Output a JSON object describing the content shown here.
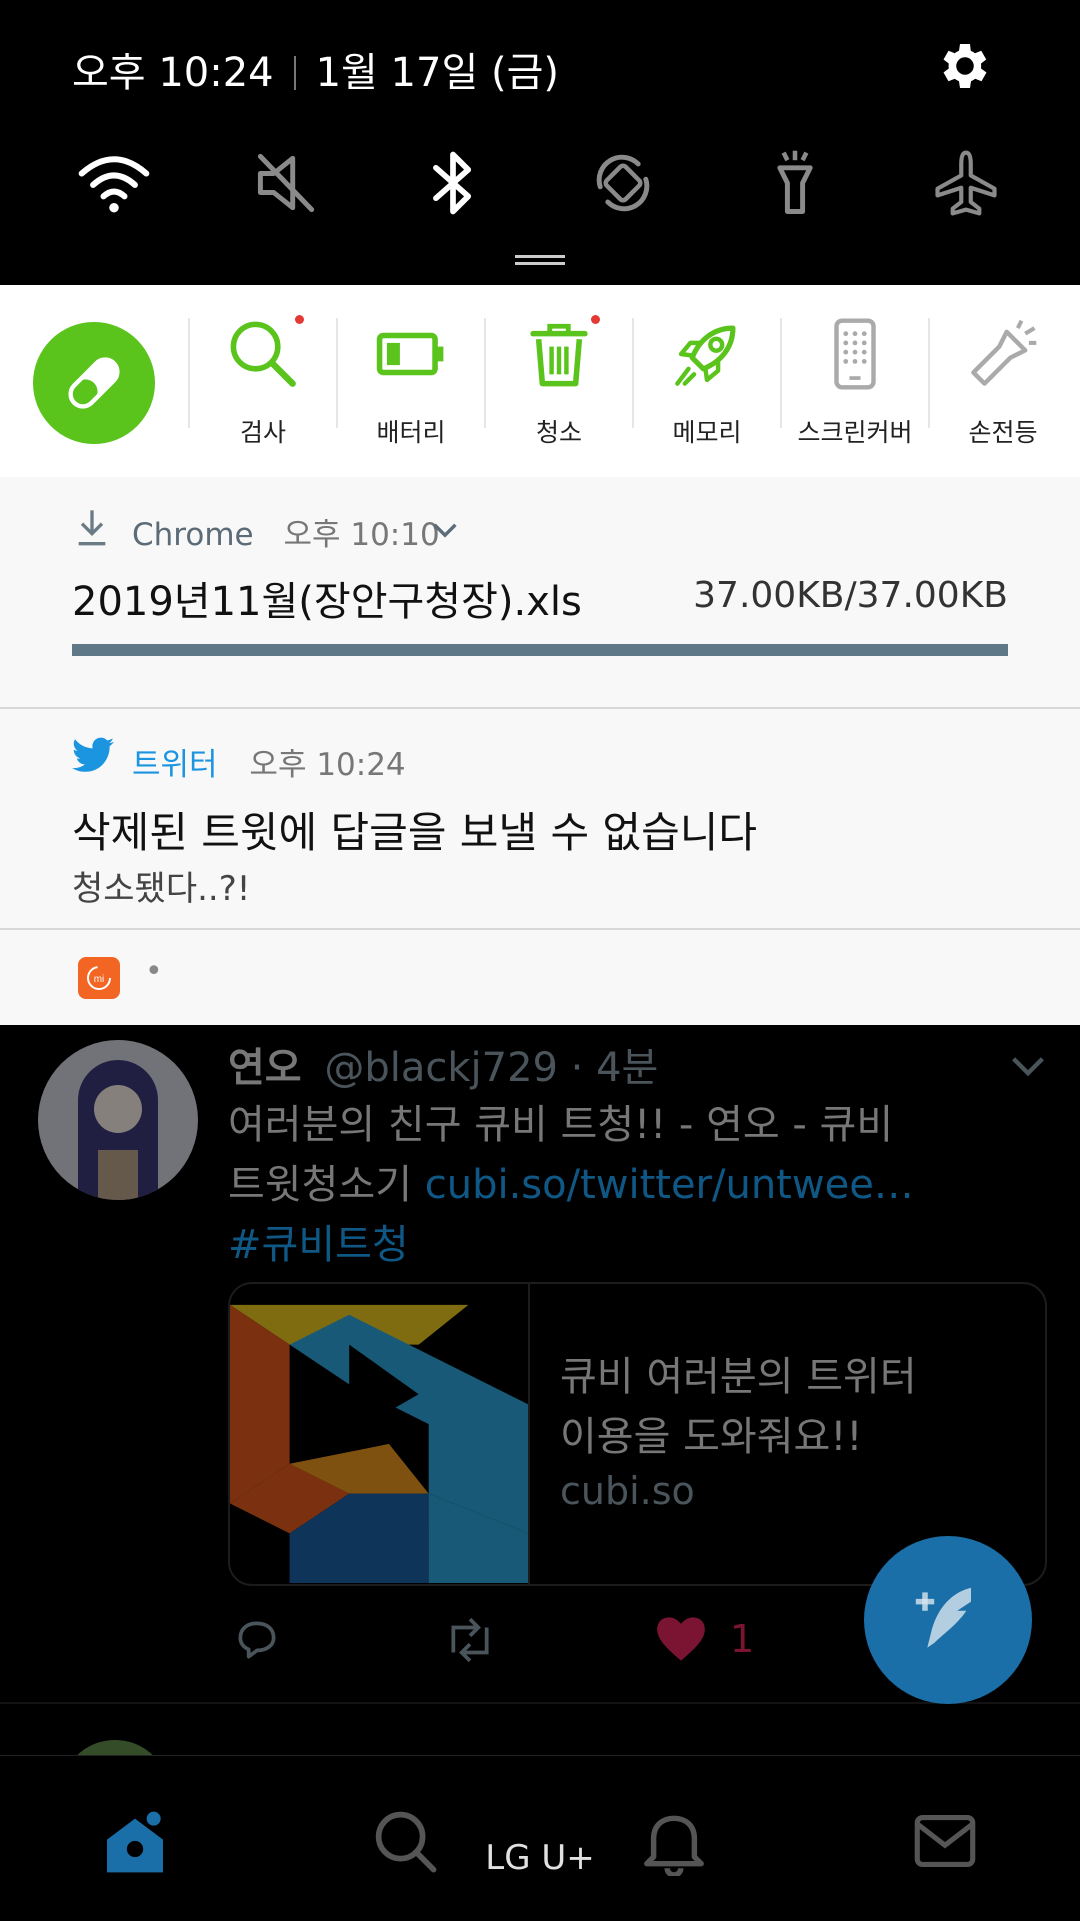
{
  "status": {
    "time": "오후 10:24",
    "date": "1월 17일 (금)",
    "settings_icon": "gear-icon",
    "toggles": [
      {
        "name": "wifi-icon",
        "active": true
      },
      {
        "name": "mute-icon",
        "active": false
      },
      {
        "name": "bluetooth-icon",
        "active": true
      },
      {
        "name": "auto-rotate-icon",
        "active": false
      },
      {
        "name": "flashlight-icon",
        "active": false
      },
      {
        "name": "airplane-mode-icon",
        "active": false
      }
    ]
  },
  "optimizer": {
    "accent": "#5ac31c",
    "items": [
      {
        "label": "검사",
        "icon": "search-icon",
        "badge": true
      },
      {
        "label": "배터리",
        "icon": "battery-icon",
        "badge": false
      },
      {
        "label": "청소",
        "icon": "trash-icon",
        "badge": true
      },
      {
        "label": "메모리",
        "icon": "rocket-icon",
        "badge": false
      },
      {
        "label": "스크린커버",
        "icon": "screen-cover-icon",
        "badge": false
      },
      {
        "label": "손전등",
        "icon": "flashlight-icon",
        "badge": false
      }
    ]
  },
  "notifications": {
    "chrome": {
      "app": "Chrome",
      "time": "오후 10:10",
      "filename": "2019년11월(장안구청장).xls",
      "size": "37.00KB/37.00KB",
      "progress": 1.0
    },
    "twitter": {
      "app": "트위터",
      "time": "오후 10:24",
      "title": "삭제된 트윗에 답글을 보낼 수 없습니다",
      "body": "청소됐다..?!"
    },
    "mi": {
      "text": "•"
    }
  },
  "tweet": {
    "name": "연오",
    "handle": "@blackj729 · 4분",
    "text_line1": "여러분의 친구 큐비 트청!! - 연오 - 큐비",
    "text_line2": "트윗청소기 ",
    "link": "cubi.so/twitter/untwee…",
    "hashtag": "#큐비트청",
    "card_title_1": "큐비 여러분의 트위터",
    "card_title_2": "이용을 도와줘요!!",
    "card_domain": "cubi.so",
    "likes": "1"
  },
  "nav": {
    "carrier": "LG U+",
    "tabs": [
      "home-icon",
      "search-icon",
      "notifications-icon",
      "messages-icon"
    ]
  }
}
